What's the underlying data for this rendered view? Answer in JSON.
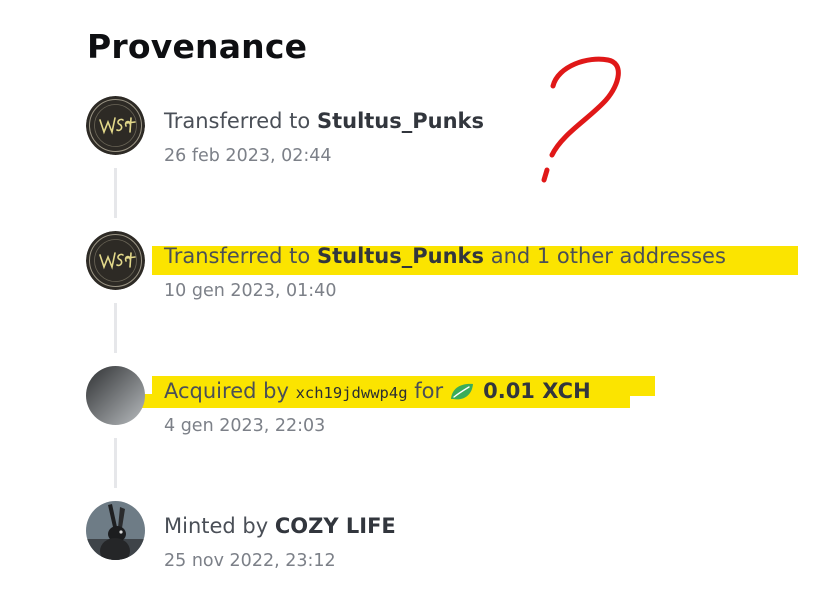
{
  "title": "Provenance",
  "events": [
    {
      "prefix": "Transferred to",
      "name": "Stultus_Punks",
      "suffix": "",
      "date": "26 feb 2023, 02:44",
      "avatar": "wsct-logo",
      "highlighted": false
    },
    {
      "prefix": "Transferred to",
      "name": "Stultus_Punks",
      "suffix": "and 1 other addresses",
      "date": "10 gen 2023, 01:40",
      "avatar": "wsct-logo",
      "highlighted": true
    },
    {
      "prefix": "Acquired by",
      "address": "xch19jdwwp4g",
      "for_label": "for",
      "amount": "0.01 XCH",
      "date": "4 gen 2023, 22:03",
      "avatar": "gray-gradient",
      "highlighted": true,
      "currency_icon": "chia-leaf-icon"
    },
    {
      "prefix": "Minted by",
      "name": "COZY LIFE",
      "suffix": "",
      "date": "25 nov 2022, 23:12",
      "avatar": "rabbit-photo",
      "highlighted": false
    }
  ],
  "annotations": {
    "question_mark": "?",
    "highlight_color": "#fbe400",
    "ink_color": "#e01818"
  }
}
